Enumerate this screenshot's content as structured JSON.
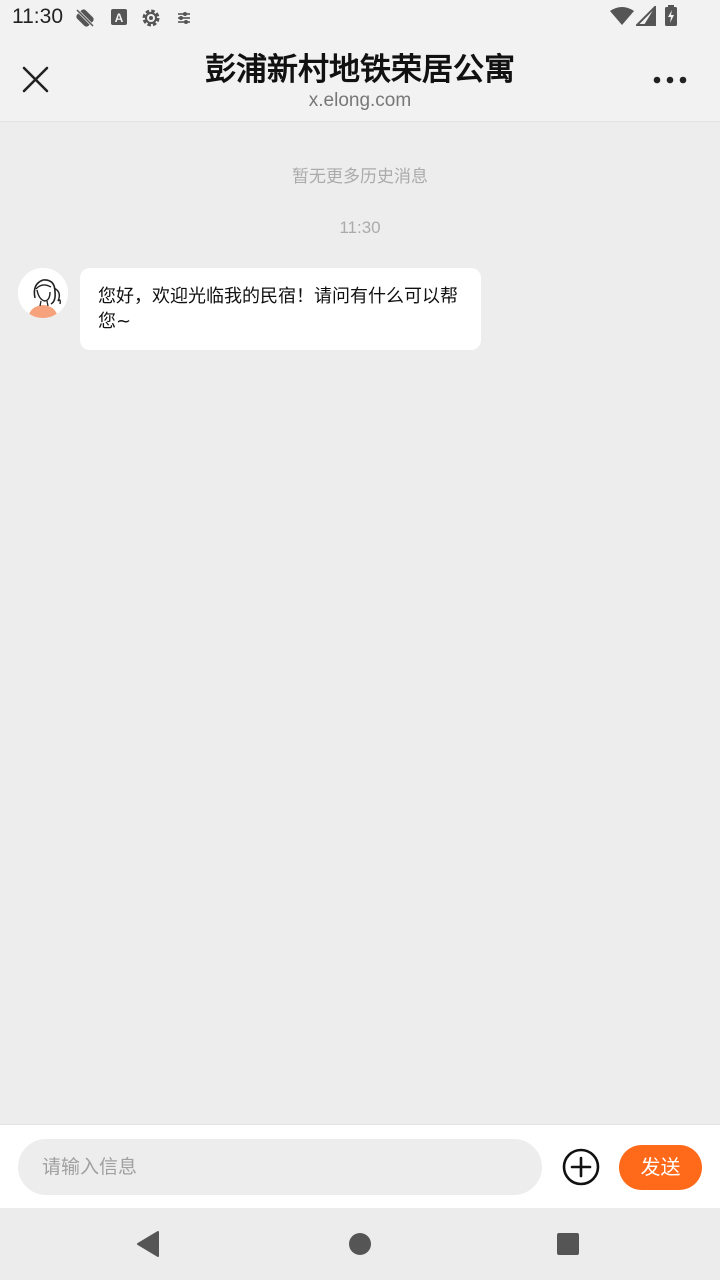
{
  "status_bar": {
    "time": "11:30",
    "left_icons": [
      "sync-off-icon",
      "a-icon",
      "settings-icon",
      "tune-icon"
    ],
    "right_icons": [
      "wifi-icon",
      "cell-signal-icon",
      "battery-charging-icon"
    ]
  },
  "header": {
    "title": "彭浦新村地铁荣居公寓",
    "subtitle": "x.elong.com",
    "close_icon": "close-icon",
    "more_icon": "more-horizontal-icon"
  },
  "chat": {
    "history_note": "暂无更多历史消息",
    "timestamp": "11:30",
    "messages": [
      {
        "sender": "host",
        "text": "您好，欢迎光临我的民宿！请问有什么可以帮您~"
      }
    ]
  },
  "input_bar": {
    "placeholder": "请输入信息",
    "value": "",
    "plus_icon": "add-circle-icon",
    "send_label": "发送"
  },
  "nav_bar": {
    "icons": [
      "back-icon",
      "home-icon",
      "recents-icon"
    ]
  },
  "colors": {
    "accent": "#ff6a1a",
    "background": "#ededed",
    "bubble": "#ffffff"
  }
}
